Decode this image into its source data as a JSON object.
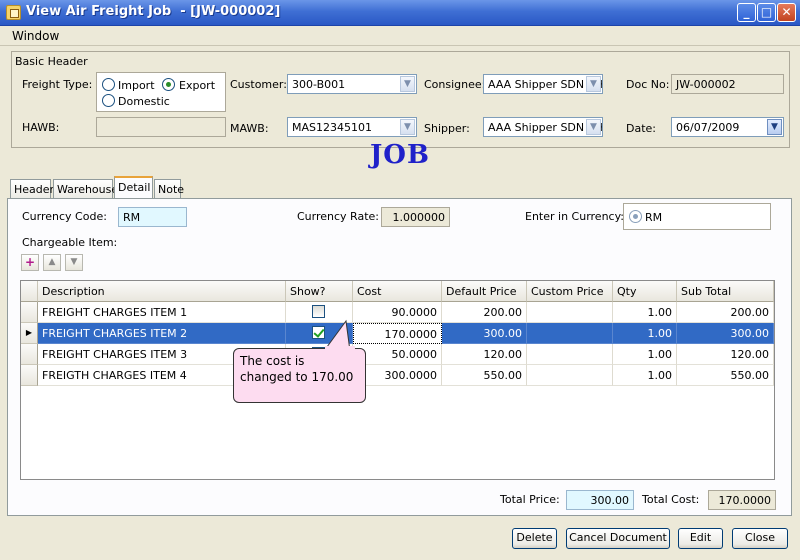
{
  "window": {
    "title": "View Air Freight Job  - [JW-000002]"
  },
  "menu": {
    "window_label": "Window"
  },
  "header": {
    "group_title": "Basic Header",
    "freight_type_label": "Freight Type:",
    "freight_options": {
      "import": "Import",
      "export": "Export",
      "domestic": "Domestic"
    },
    "customer_label": "Customer:",
    "customer_value": "300-B001",
    "consignee_label": "Consignee:",
    "consignee_value": "AAA Shipper SDN BH",
    "doc_no_label": "Doc No:",
    "doc_no_value": "JW-000002",
    "hawb_label": "HAWB:",
    "hawb_value": "",
    "mawb_label": "MAWB:",
    "mawb_value": "MAS12345101",
    "shipper_label": "Shipper:",
    "shipper_value": "AAA Shipper SDN BH",
    "date_label": "Date:",
    "date_value": "06/07/2009"
  },
  "watermark": "JOB",
  "tabs": [
    "Header",
    "Warehouse",
    "Detail",
    "Note"
  ],
  "detail": {
    "currency_code_label": "Currency Code:",
    "currency_code_value": "RM",
    "currency_rate_label": "Currency Rate:",
    "currency_rate_value": "1.000000",
    "enter_currency_label": "Enter in Currency:",
    "enter_currency_option": "RM",
    "chargeable_label": "Chargeable Item:"
  },
  "grid": {
    "columns": [
      "Description",
      "Show?",
      "Cost",
      "Default Price",
      "Custom Price",
      "Qty",
      "Sub Total"
    ],
    "rows": [
      {
        "description": "FREIGHT CHARGES ITEM 1",
        "show": false,
        "cost": "90.0000",
        "default_price": "200.00",
        "custom_price": "",
        "qty": "1.00",
        "sub_total": "200.00"
      },
      {
        "description": "FREIGHT CHARGES ITEM 2",
        "show": true,
        "cost": "170.0000",
        "default_price": "300.00",
        "custom_price": "",
        "qty": "1.00",
        "sub_total": "300.00"
      },
      {
        "description": "FREIGHT CHARGES ITEM 3",
        "show": false,
        "cost": "50.0000",
        "default_price": "120.00",
        "custom_price": "",
        "qty": "1.00",
        "sub_total": "120.00"
      },
      {
        "description": "FREIGTH CHARGES ITEM 4",
        "show": false,
        "cost": "300.0000",
        "default_price": "550.00",
        "custom_price": "",
        "qty": "1.00",
        "sub_total": "550.00"
      }
    ]
  },
  "callout": "The cost is changed to 170.00",
  "totals": {
    "total_price_label": "Total Price:",
    "total_price_value": "300.00",
    "total_cost_label": "Total Cost:",
    "total_cost_value": "170.0000"
  },
  "buttons": {
    "delete": "Delete",
    "cancel_document": "Cancel Document",
    "edit": "Edit",
    "close": "Close"
  }
}
